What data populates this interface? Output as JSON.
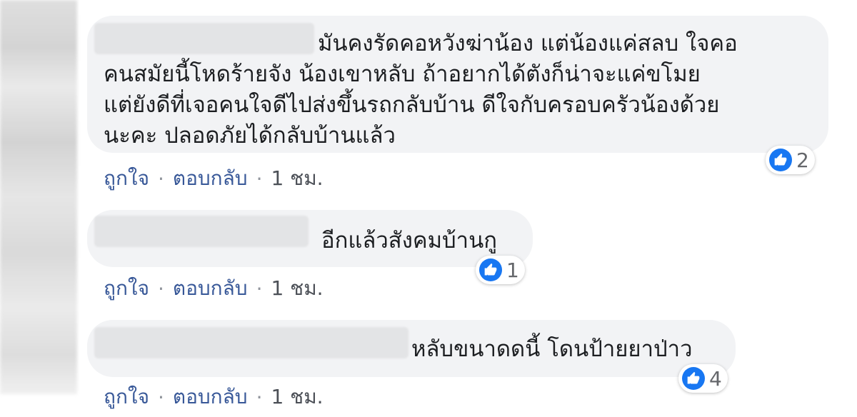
{
  "comments": [
    {
      "text": "มันคงรัดคอหวังฆ่าน้อง แต่น้องแค่สลบ ใจคอ\nคนสมัยนี้โหดร้ายจัง น้องเขาหลับ ถ้าอยากได้ตังก็น่าจะแค่ขโมย\nแต่ยังดีที่เจอคนใจดีไปส่งขึ้นรถกลับบ้าน ดีใจกับครอบครัวน้องด้วย\nนะคะ ปลอดภัยได้กลับบ้านแล้ว",
      "reaction_count": "2",
      "like_label": "ถูกใจ",
      "reply_label": "ตอบกลับ",
      "time": "1 ชม."
    },
    {
      "text": "อีกแล้วสังคมบ้านกู",
      "reaction_count": "1",
      "like_label": "ถูกใจ",
      "reply_label": "ตอบกลับ",
      "time": "1 ชม."
    },
    {
      "text": "หลับขนาดดนี้ โดนป้ายยาป่าว",
      "reaction_count": "4",
      "like_label": "ถูกใจ",
      "reply_label": "ตอบกลับ",
      "time": "1 ชม."
    }
  ],
  "separator": "·",
  "colors": {
    "bubble": "#f2f3f5",
    "link": "#385898",
    "like_blue": "#1877f2"
  },
  "icons": {
    "reaction": "thumbs-up-icon",
    "avatar": "blurred-avatar"
  }
}
